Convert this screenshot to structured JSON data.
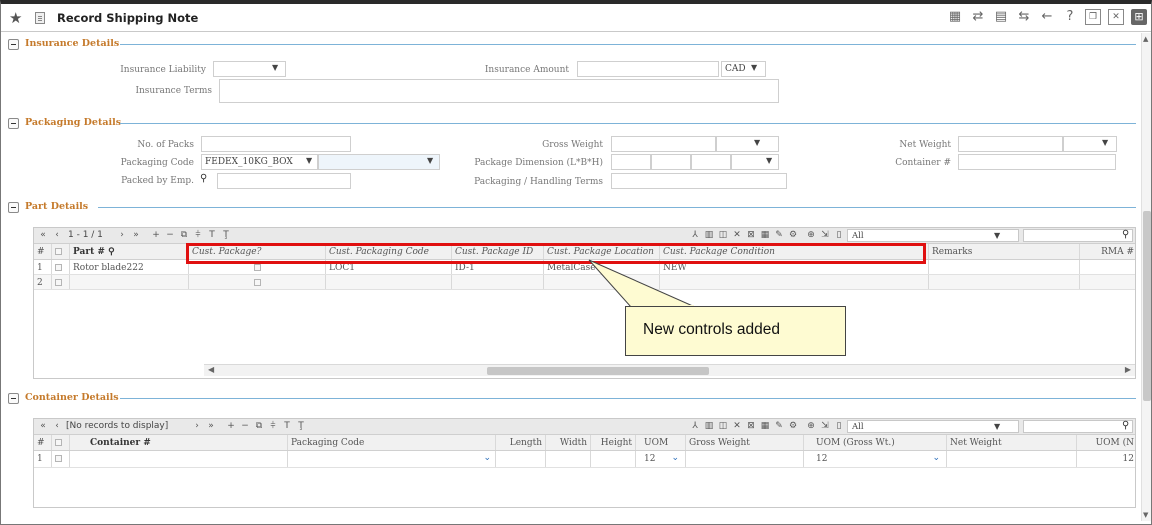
{
  "window": {
    "title": "Record Shipping Note"
  },
  "sections": {
    "insurance": "Insurance Details",
    "packaging": "Packaging Details",
    "parts": "Part Details",
    "container": "Container Details"
  },
  "insurance": {
    "liability_label": "Insurance Liability",
    "liability_value": "",
    "amount_label": "Insurance Amount",
    "amount_value": "",
    "currency": "CAD",
    "terms_label": "Insurance Terms",
    "terms_value": ""
  },
  "packaging": {
    "packs_label": "No. of Packs",
    "packs_value": "",
    "gross_label": "Gross Weight",
    "net_label": "Net Weight",
    "code_label": "Packaging Code",
    "code_value": "FEDEX_10KG_BOX",
    "dim_label": "Package Dimension (L*B*H)",
    "container_label": "Container #",
    "packed_label": "Packed by Emp.",
    "terms_label": "Packaging / Handling Terms"
  },
  "parts_grid": {
    "pager": "1 - 1 / 1",
    "filter": "All",
    "columns": [
      "#",
      "",
      "Part #",
      "Cust. Package?",
      "Cust. Packaging Code",
      "Cust. Package ID",
      "Cust. Package Location",
      "Cust. Package Condition",
      "Remarks",
      "RMA #"
    ],
    "rows": [
      {
        "num": "1",
        "part": "Rotor blade222",
        "code": "LOC1",
        "pkgid": "ID-1",
        "location": "MetalCase",
        "condition": "NEW",
        "remarks": "",
        "rma": ""
      },
      {
        "num": "2",
        "part": "",
        "code": "",
        "pkgid": "",
        "location": "",
        "condition": "",
        "remarks": "",
        "rma": ""
      }
    ]
  },
  "container_grid": {
    "pager": "[No records to display]",
    "filter": "All",
    "columns": [
      "#",
      "",
      "Container #",
      "Packaging Code",
      "Length",
      "Width",
      "Height",
      "UOM",
      "Gross Weight",
      "UOM (Gross Wt.)",
      "Net Weight",
      "UOM (N"
    ],
    "rows": [
      {
        "num": "1",
        "uom": "12",
        "uom_gross": "12",
        "net_uom": "12"
      }
    ]
  },
  "annotation": {
    "callout_text": "New controls added",
    "highlight_color": "#e01010",
    "callout_fill": "#fefbd2"
  },
  "colors": {
    "section_title": "#c57a2b",
    "section_line": "#7db3d8"
  }
}
